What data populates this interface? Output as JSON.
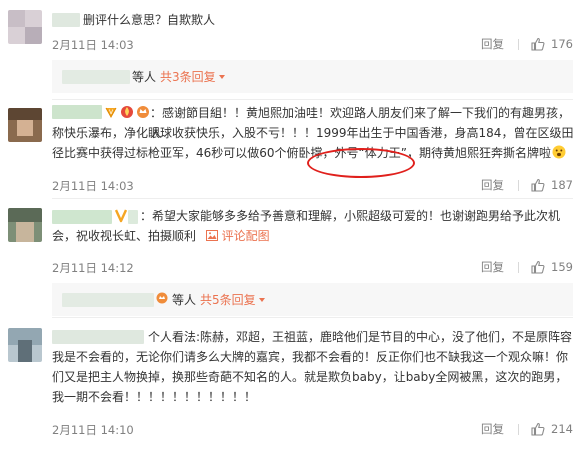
{
  "comments": [
    {
      "text": "删评什么意思？自欺欺人",
      "time": "2月11日 14:03",
      "reply_label": "回复",
      "likes": "176",
      "sub_people": "等人",
      "sub_link": "共3条回复"
    },
    {
      "text_lines": [
        "：感谢節目組！！黄旭熙加油哇！欢迎路人朋友们来了解一下我们的有趣男孩，人",
        "称快乐瀑布，净化眼球收获快乐，入股不亏！！！1999年出生于中国香港，身高184，曾在区级田",
        "径比赛中获得过标枪亚军，46秒可以做60个俯卧撑，外号“体力王”，期待黄旭熙狂奔撕名牌啦"
      ],
      "time": "2月11日 14:03",
      "reply_label": "回复",
      "likes": "187"
    },
    {
      "text_lines": [
        "：希望大家能够多多给予善意和理解，小熙超级可爱的！也谢谢跑男给予此次机",
        "会，祝收视长虹、拍摄顺利"
      ],
      "album_label": "评论配图",
      "time": "2月11日 14:12",
      "reply_label": "回复",
      "likes": "159",
      "sub_people": "等人",
      "sub_link": "共5条回复"
    },
    {
      "text_lines": [
        "个人看法:陈赫，邓超，王祖蓝，鹿晗他们是节目的中心，没了他们，不是原阵容",
        "我是不会看的，无论你们请多么大牌的嘉宾，我都不会看的！反正你们也不缺我这一个观众嘛！你",
        "们又是把主人物换掉，换那些奇葩不知名的人。就是欺负baby，让baby全网被黑，这次的跑男，",
        "我一期不会看！！！！！！！！！！！"
      ],
      "time": "2月11日 14:10",
      "reply_label": "回复",
      "likes": "214"
    }
  ],
  "colors": {
    "link": "#eb7350",
    "highlight": "#e0201c",
    "meta": "#808080"
  },
  "icons": [
    "thumbs-up-icon",
    "image-icon",
    "vip-icon",
    "flame-icon",
    "crown-icon",
    "emoji-icon"
  ]
}
